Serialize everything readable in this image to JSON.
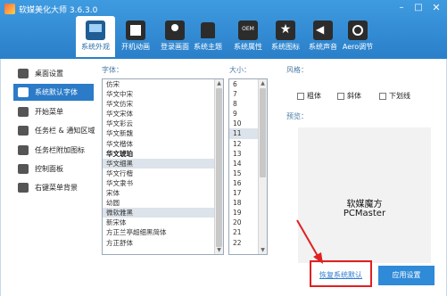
{
  "window": {
    "title": "软媒美化大师 3.6.3.0",
    "controls": [
      "–",
      "□",
      "✕"
    ]
  },
  "toolbar": {
    "items": [
      {
        "label": "系统外观",
        "icon": "computer-icon",
        "active": true
      },
      {
        "label": "开机动画",
        "icon": "film-icon",
        "active": false
      },
      {
        "label": "登录画面",
        "icon": "user-login-icon",
        "active": false
      },
      {
        "label": "系统主题",
        "icon": "shirt-icon",
        "active": false
      },
      {
        "label": "系统属性",
        "icon": "oem-icon",
        "active": false
      },
      {
        "label": "系统图标",
        "icon": "star-icon",
        "active": false
      },
      {
        "label": "系统声音",
        "icon": "speaker-icon",
        "active": false
      },
      {
        "label": "Aero调节",
        "icon": "aero-icon",
        "active": false
      }
    ]
  },
  "sidebar": {
    "items": [
      {
        "label": "桌面设置",
        "icon": "desktop-settings-icon",
        "active": false
      },
      {
        "label": "系统默认字体",
        "icon": "font-icon",
        "active": true
      },
      {
        "label": "开始菜单",
        "icon": "start-menu-icon",
        "active": false
      },
      {
        "label": "任务栏 & 通知区域",
        "icon": "taskbar-icon",
        "active": false
      },
      {
        "label": "任务栏附加图标",
        "icon": "taskbar-extra-icon",
        "active": false
      },
      {
        "label": "控制面板",
        "icon": "control-panel-icon",
        "active": false
      },
      {
        "label": "右键菜单背景",
        "icon": "context-menu-icon",
        "active": false
      }
    ]
  },
  "font_section": {
    "heading": "字体：",
    "fonts": [
      {
        "name": "仿宋",
        "selected": false,
        "bold": false
      },
      {
        "name": "华文中宋",
        "selected": false,
        "bold": false
      },
      {
        "name": "华文仿宋",
        "selected": false,
        "bold": false
      },
      {
        "name": "华文宋体",
        "selected": false,
        "bold": false
      },
      {
        "name": "华文彩云",
        "selected": false,
        "bold": false
      },
      {
        "name": "华文新魏",
        "selected": false,
        "bold": false
      },
      {
        "name": "华文楷体",
        "selected": false,
        "bold": false
      },
      {
        "name": "华文琥珀",
        "selected": false,
        "bold": true
      },
      {
        "name": "华文细黑",
        "selected": true,
        "bold": false
      },
      {
        "name": "华文行楷",
        "selected": false,
        "bold": false
      },
      {
        "name": "华文隶书",
        "selected": false,
        "bold": false
      },
      {
        "name": "宋体",
        "selected": false,
        "bold": false
      },
      {
        "name": "幼圆",
        "selected": false,
        "bold": false
      },
      {
        "name": "微软雅黑",
        "selected": true,
        "bold": false
      },
      {
        "name": "新宋体",
        "selected": false,
        "bold": false
      },
      {
        "name": "方正兰亭超细黑简体",
        "selected": false,
        "bold": false
      },
      {
        "name": "方正舒体",
        "selected": false,
        "bold": false
      }
    ]
  },
  "size_section": {
    "heading": "大小：",
    "sizes": [
      {
        "value": "6",
        "selected": false
      },
      {
        "value": "7",
        "selected": false
      },
      {
        "value": "8",
        "selected": false
      },
      {
        "value": "9",
        "selected": false
      },
      {
        "value": "10",
        "selected": false
      },
      {
        "value": "11",
        "selected": true
      },
      {
        "value": "12",
        "selected": false
      },
      {
        "value": "13",
        "selected": false
      },
      {
        "value": "14",
        "selected": false
      },
      {
        "value": "15",
        "selected": false
      },
      {
        "value": "16",
        "selected": false
      },
      {
        "value": "17",
        "selected": false
      },
      {
        "value": "18",
        "selected": false
      },
      {
        "value": "19",
        "selected": false
      },
      {
        "value": "20",
        "selected": false
      },
      {
        "value": "21",
        "selected": false
      },
      {
        "value": "22",
        "selected": false
      }
    ]
  },
  "style_section": {
    "heading": "风格：",
    "bold_label": "粗体",
    "italic_label": "斜体",
    "underline_label": "下划线"
  },
  "preview_section": {
    "heading": "预览：",
    "line1": "软媒魔方",
    "line2": "PCMaster"
  },
  "actions": {
    "restore_label": "恢复系统默认",
    "apply_label": "应用设置"
  },
  "colors": {
    "accent": "#2b7bc8",
    "annotation": "#e02020",
    "link": "#2e7ad0"
  }
}
